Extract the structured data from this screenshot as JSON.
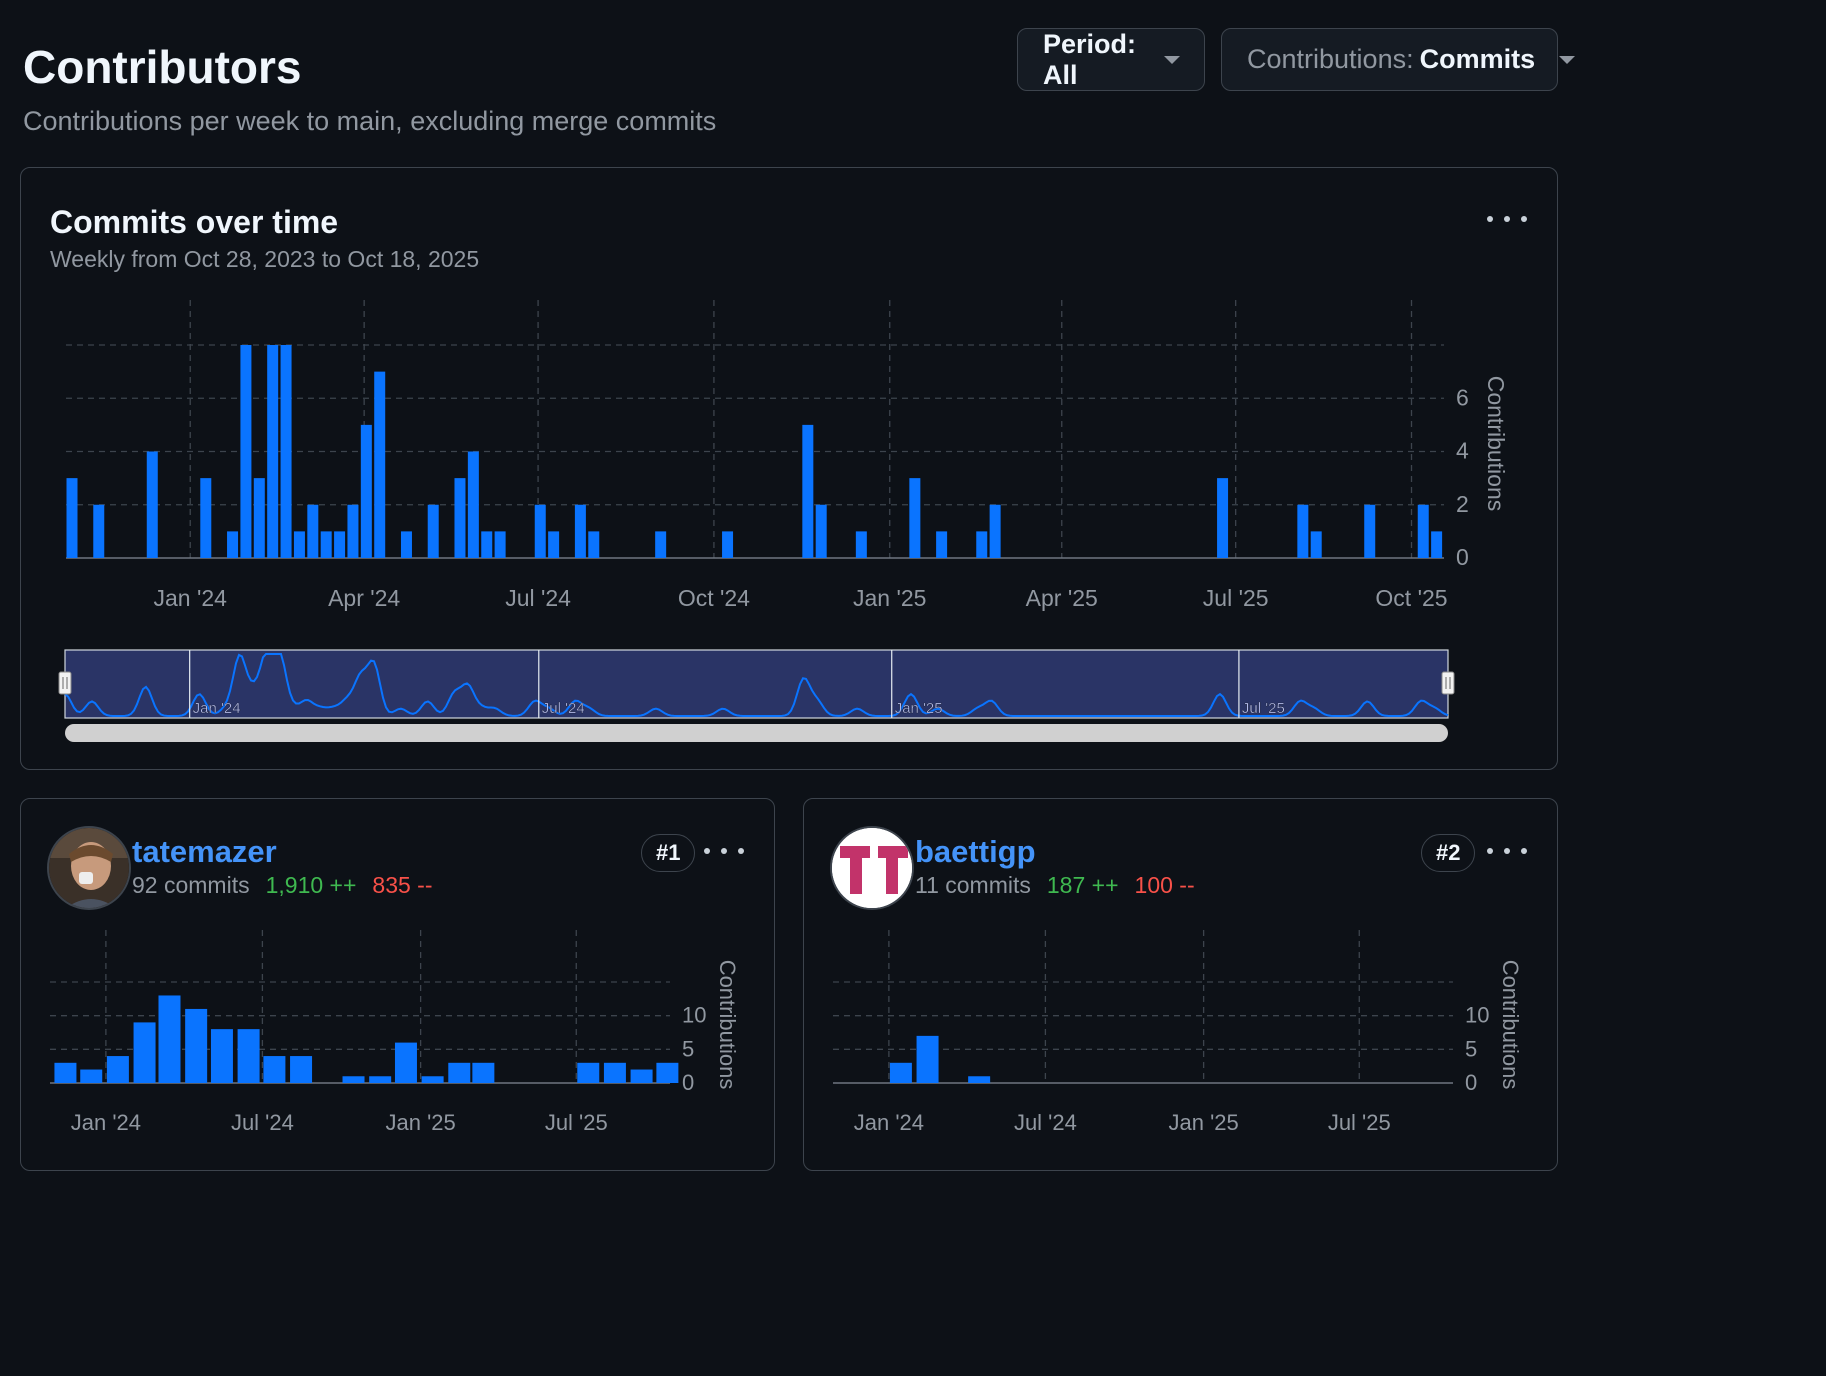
{
  "header": {
    "title": "Contributors",
    "subtitle": "Contributions per week to main, excluding merge commits"
  },
  "filters": {
    "period_label": "Period: All",
    "contributions_label": "Contributions:",
    "contributions_value": "Commits"
  },
  "colors": {
    "bar": "#0a74ff",
    "grid": "#3d444d",
    "additions": "#3fb950",
    "deletions": "#f85149",
    "link": "#4493f8"
  },
  "overview": {
    "title": "Commits over time",
    "subtitle": "Weekly from Oct 28, 2023 to Oct 18, 2025",
    "navigator_labels": [
      "Jan '24",
      "Jul '24",
      "Jan '25",
      "Jul '25"
    ]
  },
  "contributors": [
    {
      "username": "tatemazer",
      "commits": "92 commits",
      "additions": "1,910 ++",
      "deletions": "835 --",
      "rank": "#1",
      "avatar_icon": "user-photo-avatar"
    },
    {
      "username": "baettigp",
      "commits": "11 commits",
      "additions": "187 ++",
      "deletions": "100 --",
      "rank": "#2",
      "avatar_icon": "identicon-avatar"
    }
  ],
  "chart_data": [
    {
      "type": "bar",
      "title": "Commits over time",
      "ylabel": "Contributions",
      "ylim": [
        0,
        8
      ],
      "yticks": [
        0,
        2,
        4,
        6
      ],
      "xticks": [
        "Jan '24",
        "Apr '24",
        "Jul '24",
        "Oct '24",
        "Jan '25",
        "Apr '25",
        "Jul '25",
        "Oct '25"
      ],
      "x_range": [
        "2023-10-28",
        "2025-10-18"
      ],
      "grid": true,
      "x": [
        "2023-10-28",
        "2023-11-11",
        "2023-12-09",
        "2024-01-06",
        "2024-01-20",
        "2024-01-27",
        "2024-02-03",
        "2024-02-10",
        "2024-02-17",
        "2024-02-24",
        "2024-03-02",
        "2024-03-09",
        "2024-03-16",
        "2024-03-23",
        "2024-03-30",
        "2024-04-06",
        "2024-04-20",
        "2024-05-04",
        "2024-05-18",
        "2024-05-25",
        "2024-06-01",
        "2024-06-08",
        "2024-06-29",
        "2024-07-06",
        "2024-07-20",
        "2024-07-27",
        "2024-08-31",
        "2024-10-05",
        "2024-11-16",
        "2024-11-23",
        "2024-12-14",
        "2025-01-11",
        "2025-01-25",
        "2025-02-15",
        "2025-02-22",
        "2025-06-21",
        "2025-08-02",
        "2025-08-09",
        "2025-09-06",
        "2025-10-04",
        "2025-10-11"
      ],
      "values": [
        3,
        2,
        4,
        3,
        1,
        8,
        3,
        8,
        8,
        1,
        2,
        1,
        1,
        2,
        5,
        7,
        1,
        2,
        3,
        4,
        1,
        1,
        2,
        1,
        2,
        1,
        1,
        1,
        5,
        2,
        1,
        3,
        1,
        1,
        2,
        3,
        2,
        1,
        2,
        2,
        1
      ]
    },
    {
      "type": "bar",
      "title": "tatemazer",
      "ylabel": "Contributions",
      "ylim": [
        0,
        15
      ],
      "yticks": [
        0,
        5,
        10
      ],
      "xticks": [
        "Jan '24",
        "Jul '24",
        "Jan '25",
        "Jul '25"
      ],
      "x_range": [
        "2023-10-28",
        "2025-10-18"
      ],
      "grid": true,
      "x": [
        "2023-11",
        "2023-12",
        "2024-01",
        "2024-02",
        "2024-03",
        "2024-04",
        "2024-05",
        "2024-06",
        "2024-07",
        "2024-08",
        "2024-10",
        "2024-11",
        "2024-12",
        "2025-01",
        "2025-02",
        "2025-03",
        "2025-07",
        "2025-08",
        "2025-09",
        "2025-10"
      ],
      "values": [
        3,
        2,
        4,
        9,
        13,
        11,
        8,
        8,
        4,
        4,
        1,
        1,
        6,
        1,
        3,
        3,
        3,
        3,
        2,
        3
      ]
    },
    {
      "type": "bar",
      "title": "baettigp",
      "ylabel": "Contributions",
      "ylim": [
        0,
        15
      ],
      "yticks": [
        0,
        5,
        10
      ],
      "xticks": [
        "Jan '24",
        "Jul '24",
        "Jan '25",
        "Jul '25"
      ],
      "x_range": [
        "2023-10-28",
        "2025-10-18"
      ],
      "grid": true,
      "x": [
        "2024-01",
        "2024-02",
        "2024-04"
      ],
      "values": [
        3,
        7,
        1
      ]
    }
  ]
}
